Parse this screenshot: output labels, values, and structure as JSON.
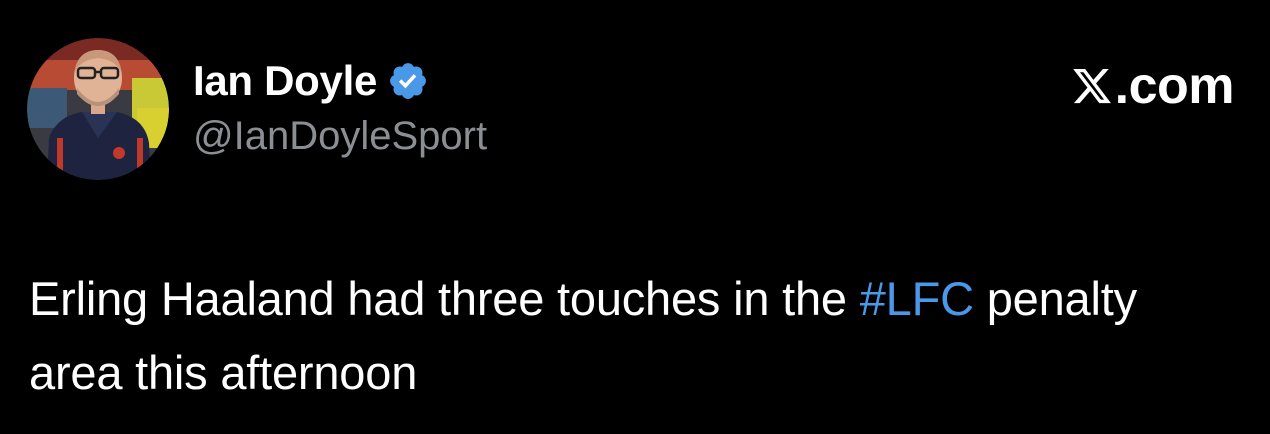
{
  "author": {
    "display_name": "Ian Doyle",
    "handle": "@IanDoyleSport",
    "verified_icon": "verified-badge-icon",
    "verified_color": "#4a99e9"
  },
  "brand": {
    "logo_icon": "x-logo-icon",
    "text": ".com"
  },
  "tweet": {
    "text_before": "Erling Haaland had three touches in the ",
    "hashtag": "#LFC",
    "text_after": " penalty area this afternoon"
  },
  "colors": {
    "background": "#000000",
    "text": "#ffffff",
    "secondary_text": "#8b8f94",
    "link": "#4a99e9"
  }
}
